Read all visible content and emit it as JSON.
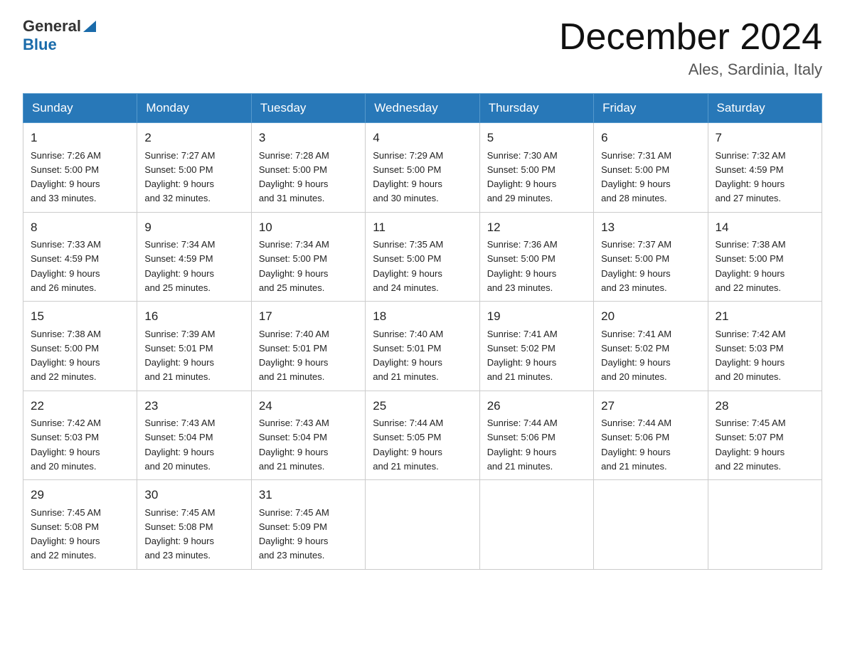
{
  "header": {
    "logo_general": "General",
    "logo_blue": "Blue",
    "month_title": "December 2024",
    "location": "Ales, Sardinia, Italy"
  },
  "days_of_week": [
    "Sunday",
    "Monday",
    "Tuesday",
    "Wednesday",
    "Thursday",
    "Friday",
    "Saturday"
  ],
  "weeks": [
    [
      {
        "day": "1",
        "sunrise": "7:26 AM",
        "sunset": "5:00 PM",
        "daylight": "9 hours and 33 minutes."
      },
      {
        "day": "2",
        "sunrise": "7:27 AM",
        "sunset": "5:00 PM",
        "daylight": "9 hours and 32 minutes."
      },
      {
        "day": "3",
        "sunrise": "7:28 AM",
        "sunset": "5:00 PM",
        "daylight": "9 hours and 31 minutes."
      },
      {
        "day": "4",
        "sunrise": "7:29 AM",
        "sunset": "5:00 PM",
        "daylight": "9 hours and 30 minutes."
      },
      {
        "day": "5",
        "sunrise": "7:30 AM",
        "sunset": "5:00 PM",
        "daylight": "9 hours and 29 minutes."
      },
      {
        "day": "6",
        "sunrise": "7:31 AM",
        "sunset": "5:00 PM",
        "daylight": "9 hours and 28 minutes."
      },
      {
        "day": "7",
        "sunrise": "7:32 AM",
        "sunset": "4:59 PM",
        "daylight": "9 hours and 27 minutes."
      }
    ],
    [
      {
        "day": "8",
        "sunrise": "7:33 AM",
        "sunset": "4:59 PM",
        "daylight": "9 hours and 26 minutes."
      },
      {
        "day": "9",
        "sunrise": "7:34 AM",
        "sunset": "4:59 PM",
        "daylight": "9 hours and 25 minutes."
      },
      {
        "day": "10",
        "sunrise": "7:34 AM",
        "sunset": "5:00 PM",
        "daylight": "9 hours and 25 minutes."
      },
      {
        "day": "11",
        "sunrise": "7:35 AM",
        "sunset": "5:00 PM",
        "daylight": "9 hours and 24 minutes."
      },
      {
        "day": "12",
        "sunrise": "7:36 AM",
        "sunset": "5:00 PM",
        "daylight": "9 hours and 23 minutes."
      },
      {
        "day": "13",
        "sunrise": "7:37 AM",
        "sunset": "5:00 PM",
        "daylight": "9 hours and 23 minutes."
      },
      {
        "day": "14",
        "sunrise": "7:38 AM",
        "sunset": "5:00 PM",
        "daylight": "9 hours and 22 minutes."
      }
    ],
    [
      {
        "day": "15",
        "sunrise": "7:38 AM",
        "sunset": "5:00 PM",
        "daylight": "9 hours and 22 minutes."
      },
      {
        "day": "16",
        "sunrise": "7:39 AM",
        "sunset": "5:01 PM",
        "daylight": "9 hours and 21 minutes."
      },
      {
        "day": "17",
        "sunrise": "7:40 AM",
        "sunset": "5:01 PM",
        "daylight": "9 hours and 21 minutes."
      },
      {
        "day": "18",
        "sunrise": "7:40 AM",
        "sunset": "5:01 PM",
        "daylight": "9 hours and 21 minutes."
      },
      {
        "day": "19",
        "sunrise": "7:41 AM",
        "sunset": "5:02 PM",
        "daylight": "9 hours and 21 minutes."
      },
      {
        "day": "20",
        "sunrise": "7:41 AM",
        "sunset": "5:02 PM",
        "daylight": "9 hours and 20 minutes."
      },
      {
        "day": "21",
        "sunrise": "7:42 AM",
        "sunset": "5:03 PM",
        "daylight": "9 hours and 20 minutes."
      }
    ],
    [
      {
        "day": "22",
        "sunrise": "7:42 AM",
        "sunset": "5:03 PM",
        "daylight": "9 hours and 20 minutes."
      },
      {
        "day": "23",
        "sunrise": "7:43 AM",
        "sunset": "5:04 PM",
        "daylight": "9 hours and 20 minutes."
      },
      {
        "day": "24",
        "sunrise": "7:43 AM",
        "sunset": "5:04 PM",
        "daylight": "9 hours and 21 minutes."
      },
      {
        "day": "25",
        "sunrise": "7:44 AM",
        "sunset": "5:05 PM",
        "daylight": "9 hours and 21 minutes."
      },
      {
        "day": "26",
        "sunrise": "7:44 AM",
        "sunset": "5:06 PM",
        "daylight": "9 hours and 21 minutes."
      },
      {
        "day": "27",
        "sunrise": "7:44 AM",
        "sunset": "5:06 PM",
        "daylight": "9 hours and 21 minutes."
      },
      {
        "day": "28",
        "sunrise": "7:45 AM",
        "sunset": "5:07 PM",
        "daylight": "9 hours and 22 minutes."
      }
    ],
    [
      {
        "day": "29",
        "sunrise": "7:45 AM",
        "sunset": "5:08 PM",
        "daylight": "9 hours and 22 minutes."
      },
      {
        "day": "30",
        "sunrise": "7:45 AM",
        "sunset": "5:08 PM",
        "daylight": "9 hours and 23 minutes."
      },
      {
        "day": "31",
        "sunrise": "7:45 AM",
        "sunset": "5:09 PM",
        "daylight": "9 hours and 23 minutes."
      },
      null,
      null,
      null,
      null
    ]
  ],
  "labels": {
    "sunrise": "Sunrise:",
    "sunset": "Sunset:",
    "daylight": "Daylight:"
  }
}
